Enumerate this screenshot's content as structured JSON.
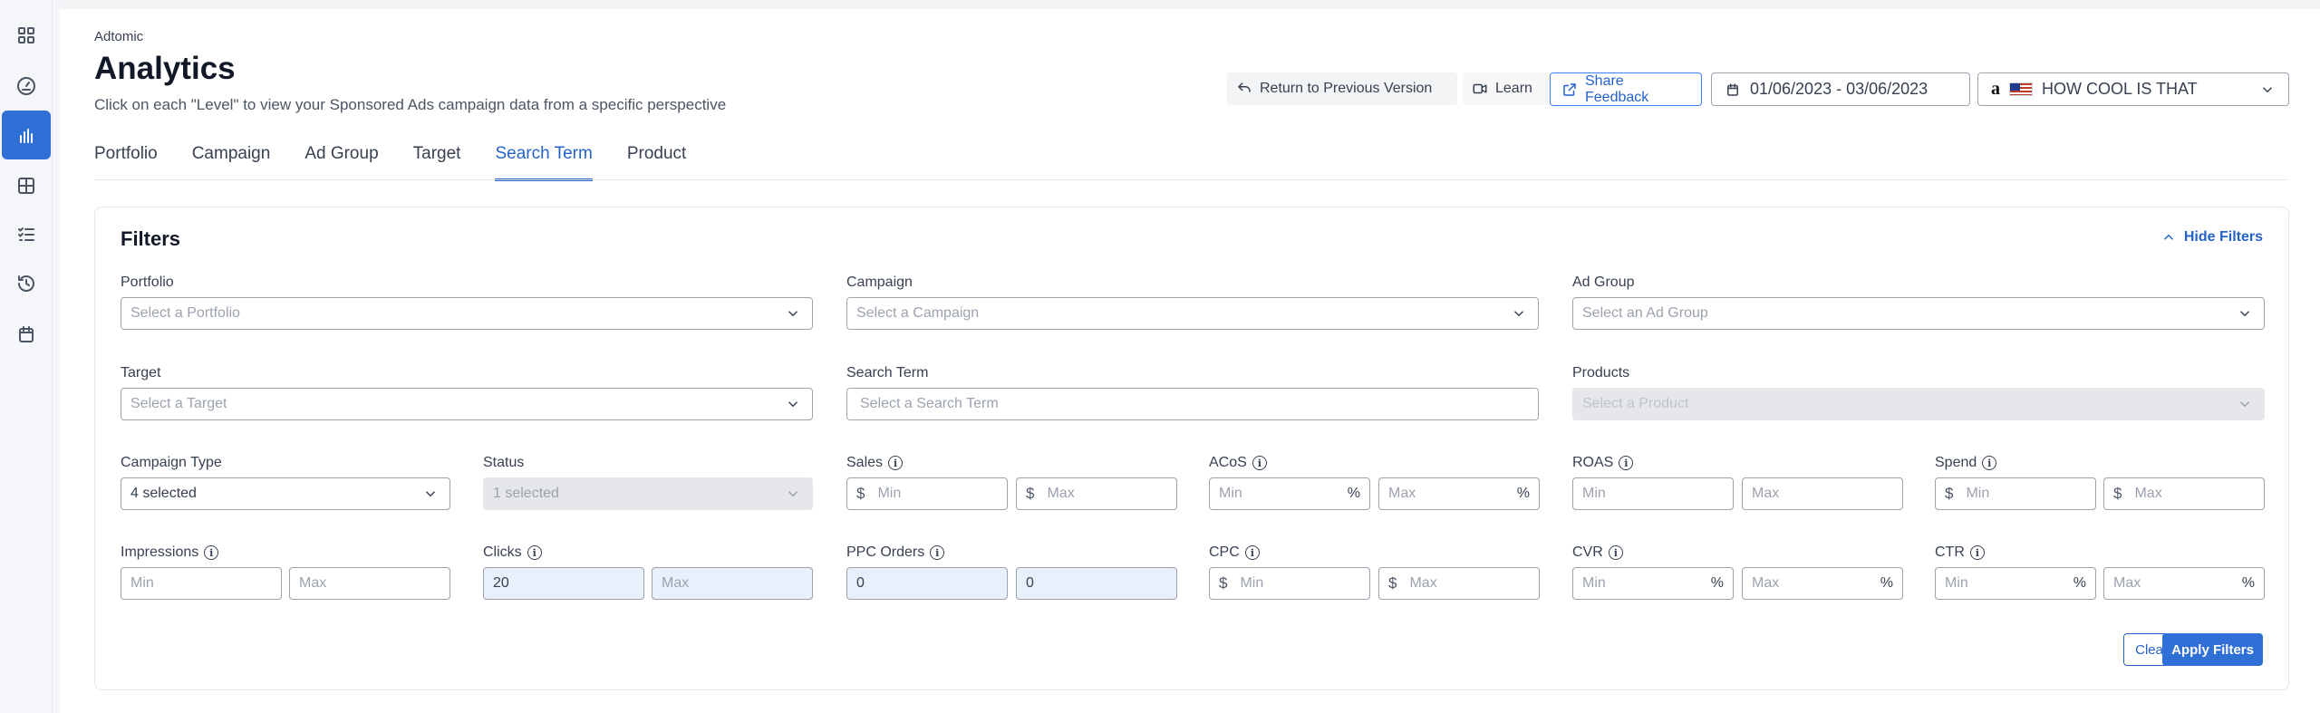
{
  "app": {
    "brand": "Adtomic",
    "title": "Analytics",
    "subtitle": "Click on each \"Level\" to view your Sponsored Ads campaign data from a specific perspective"
  },
  "sidebar": [
    {
      "icon": "grid-icon"
    },
    {
      "icon": "gauge-icon"
    },
    {
      "icon": "bar-chart-icon",
      "active": true
    },
    {
      "icon": "table-icon"
    },
    {
      "icon": "checklist-icon"
    },
    {
      "icon": "history-icon"
    },
    {
      "icon": "calendar-icon"
    }
  ],
  "header": {
    "return_label": "Return to Previous Version",
    "learn_label": "Learn",
    "feedback_label": "Share Feedback",
    "date_range": "01/06/2023 - 03/06/2023",
    "account": "HOW COOL IS THAT",
    "marketplace_logo": "a"
  },
  "tabs": [
    "Portfolio",
    "Campaign",
    "Ad Group",
    "Target",
    "Search Term",
    "Product"
  ],
  "active_tab": "Search Term",
  "filters": {
    "title": "Filters",
    "hide_label": "Hide Filters",
    "portfolio": {
      "label": "Portfolio",
      "placeholder": "Select a Portfolio"
    },
    "campaign": {
      "label": "Campaign",
      "placeholder": "Select a Campaign"
    },
    "ad_group": {
      "label": "Ad Group",
      "placeholder": "Select an Ad Group"
    },
    "target": {
      "label": "Target",
      "placeholder": "Select a Target"
    },
    "search_term": {
      "label": "Search Term",
      "placeholder": "Select a Search Term"
    },
    "products": {
      "label": "Products",
      "placeholder": "Select a Product"
    },
    "campaign_type": {
      "label": "Campaign Type",
      "value": "4 selected"
    },
    "status": {
      "label": "Status",
      "value": "1 selected"
    },
    "sales": {
      "label": "Sales",
      "prefix": "$",
      "min": "Min",
      "max": "Max"
    },
    "acos": {
      "label": "ACoS",
      "suffix": "%",
      "min": "Min",
      "max": "Max"
    },
    "roas": {
      "label": "ROAS",
      "min": "Min",
      "max": "Max"
    },
    "spend": {
      "label": "Spend",
      "prefix": "$",
      "min": "Min",
      "max": "Max"
    },
    "impressions": {
      "label": "Impressions",
      "min": "Min",
      "max": "Max"
    },
    "clicks": {
      "label": "Clicks",
      "min_value": "20",
      "max": "Max"
    },
    "ppc_orders": {
      "label": "PPC Orders",
      "min_value": "0",
      "max_value": "0"
    },
    "cpc": {
      "label": "CPC",
      "prefix": "$",
      "min": "Min",
      "max": "Max"
    },
    "cvr": {
      "label": "CVR",
      "suffix": "%",
      "min": "Min",
      "max": "Max"
    },
    "ctr": {
      "label": "CTR",
      "suffix": "%",
      "min": "Min",
      "max": "Max"
    },
    "info_glyph": "i",
    "clear_label": "Clear",
    "apply_label": "Apply Filters"
  }
}
